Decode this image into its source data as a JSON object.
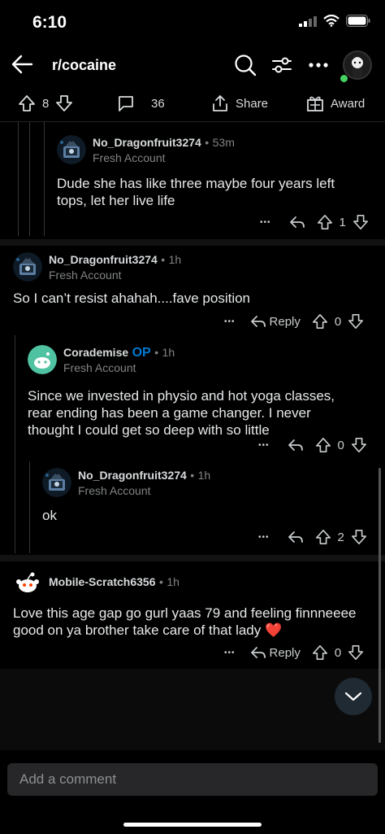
{
  "status": {
    "time": "6:10"
  },
  "nav": {
    "subreddit": "r/cocaine"
  },
  "post_actions": {
    "score": "8",
    "comments": "36",
    "share_label": "Share",
    "award_label": "Award"
  },
  "comments": [
    {
      "username": "No_Dragonfruit3274",
      "age": "53m",
      "flair": "Fresh Account",
      "body": "Dude she has like three maybe four years left tops, let her live life",
      "score": "1"
    },
    {
      "username": "No_Dragonfruit3274",
      "age": "1h",
      "flair": "Fresh Account",
      "body": "So I can’t resist ahahah....fave position",
      "reply_label": "Reply",
      "score": "0"
    },
    {
      "username": "Corademise",
      "op_label": "OP",
      "age": "1h",
      "flair": "Fresh Account",
      "body": "Since we invested in physio and hot yoga classes, rear ending has been a game changer. I never thought I could get so deep with so little",
      "score": "0"
    },
    {
      "username": "No_Dragonfruit3274",
      "age": "1h",
      "flair": "Fresh Account",
      "body": "ok",
      "score": "2"
    },
    {
      "username": "Mobile-Scratch6356",
      "age": "1h",
      "body": "Love this age gap go gurl yaas 79 and feeling finnneeee good on ya brother take care of that lady",
      "reply_label": "Reply",
      "score": "0"
    }
  ],
  "composer": {
    "placeholder": "Add a comment"
  },
  "dot_sep": "•",
  "more_glyph": "•••",
  "heart": "❤️",
  "colors": {
    "background": "#000000",
    "op": "#0079d3",
    "avatar_green": "#4fc3a1",
    "heart": "#e0245e"
  },
  "icons": [
    "back-arrow-icon",
    "search-icon",
    "filter-icon",
    "more-icon",
    "upvote-icon",
    "downvote-icon",
    "comment-icon",
    "share-icon",
    "award-icon",
    "reply-icon",
    "chevron-down-icon"
  ]
}
